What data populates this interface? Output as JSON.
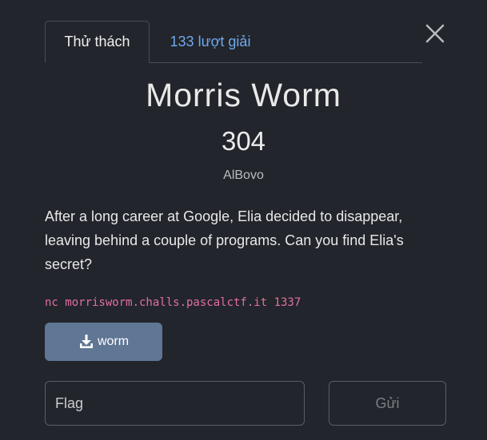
{
  "tabs": {
    "challenge_label": "Thử thách",
    "solves_label": "133 lượt giải"
  },
  "close_icon": "close-icon",
  "challenge": {
    "name": "Morris Worm",
    "value": "304",
    "author": "AlBovo",
    "description": "After a long career at Google, Elia decided to disappear, leaving behind a couple of programs. Can you find Elia's secret?",
    "connection": "nc morrisworm.challs.pascalctf.it 1337"
  },
  "files": [
    {
      "label": "worm",
      "icon": "download-icon"
    }
  ],
  "flag_form": {
    "placeholder": "Flag",
    "submit_label": "Gửi"
  },
  "colors": {
    "background": "#22252b",
    "tab_link": "#6fa8ef",
    "command_text": "#e26fa0",
    "file_button": "#5f7694"
  }
}
